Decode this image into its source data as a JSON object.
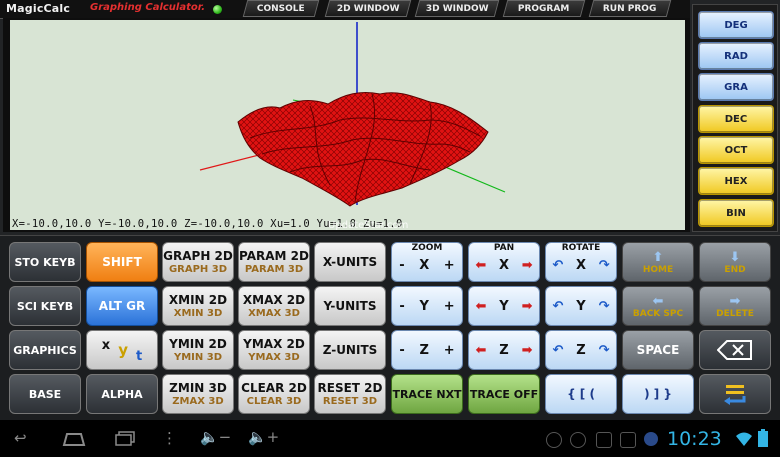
{
  "header": {
    "brand": "MagicCalc",
    "subtitle": "Graphing Calculator.",
    "menu": [
      "CONSOLE",
      "2D WINDOW",
      "3D WINDOW",
      "PROGRAM",
      "RUN PROG"
    ]
  },
  "graph": {
    "range_text": "X=-10.0,10.0 Y=-10.0,10.0 Z=-10.0,10.0 Xu=1.0 Yu=1.0 Zu=1.0",
    "watermark": "UpdateStar.com"
  },
  "modes": [
    "DEG",
    "RAD",
    "GRA",
    "DEC",
    "OCT",
    "HEX",
    "BIN"
  ],
  "keys": {
    "sto_keyb": "STO KEYB",
    "sci_keyb": "SCI KEYB",
    "graphics": "GRAPHICS",
    "base": "BASE",
    "shift": "SHIFT",
    "alt_gr": "ALT GR",
    "xyt_x": "x",
    "xyt_y": "y",
    "xyt_t": "t",
    "alpha": "ALPHA",
    "graph2d": "GRAPH 2D",
    "graph3d": "GRAPH 3D",
    "xmin2d": "XMIN 2D",
    "xmin3d": "XMIN 3D",
    "ymin2d": "YMIN 2D",
    "ymin3d": "YMIN 3D",
    "zmin3d": "ZMIN 3D",
    "zmax3d": "ZMAX 3D",
    "param2d": "PARAM 2D",
    "param3d": "PARAM 3D",
    "xmax2d": "XMAX 2D",
    "xmax3d": "XMAX 3D",
    "ymax2d": "YMAX 2D",
    "ymax3d": "YMAX 3D",
    "clear2d": "CLEAR 2D",
    "clear3d": "CLEAR 3D",
    "xunits": "X-UNITS",
    "yunits": "Y-UNITS",
    "zunits": "Z-UNITS",
    "reset2d": "RESET 2D",
    "reset3d": "RESET 3D",
    "zoom": "ZOOM",
    "pan": "PAN",
    "rotate": "ROTATE",
    "minus": "-",
    "plus": "+",
    "x": "X",
    "y": "Y",
    "z": "Z",
    "trace_nxt": "TRACE NXT",
    "trace_off": "TRACE OFF",
    "bracket_open": "{ [ (",
    "bracket_close": ") ] }",
    "home": "HOME",
    "end": "END",
    "back_spc": "BACK SPC",
    "delete": "DELETE",
    "space": "SPACE"
  },
  "status": {
    "time": "10:23"
  }
}
